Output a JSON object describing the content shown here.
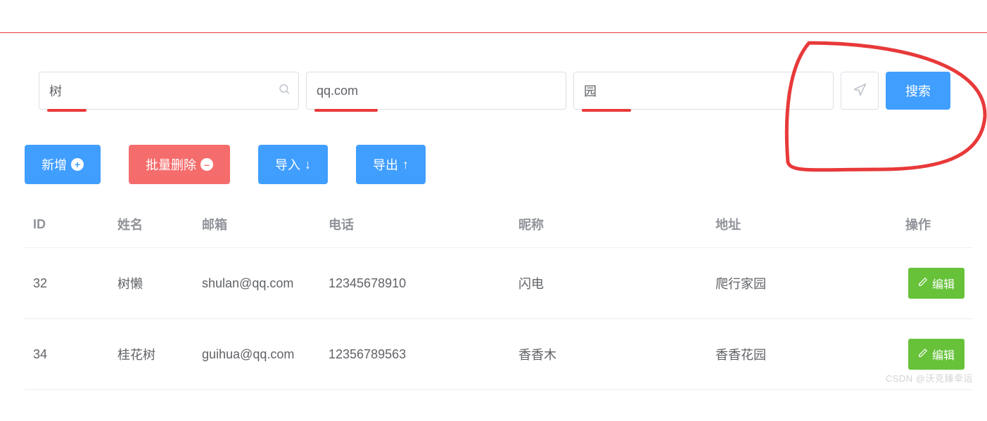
{
  "search": {
    "name_value": "树",
    "email_value": "qq.com",
    "address_value": "园",
    "search_label": "搜索"
  },
  "toolbar": {
    "add_label": "新增",
    "batch_delete_label": "批量删除",
    "import_label": "导入",
    "export_label": "导出"
  },
  "table": {
    "headers": {
      "id": "ID",
      "name": "姓名",
      "email": "邮箱",
      "phone": "电话",
      "nickname": "昵称",
      "address": "地址",
      "op": "操作"
    },
    "rows": [
      {
        "id": "32",
        "name": "树懒",
        "email": "shulan@qq.com",
        "phone": "12345678910",
        "nickname": "闪电",
        "address": "爬行家园",
        "edit_label": "编辑"
      },
      {
        "id": "34",
        "name": "桂花树",
        "email": "guihua@qq.com",
        "phone": "12356789563",
        "nickname": "香香木",
        "address": "香香花园",
        "edit_label": "编辑"
      }
    ]
  },
  "watermark": "CSDN @沃克臻幸运"
}
